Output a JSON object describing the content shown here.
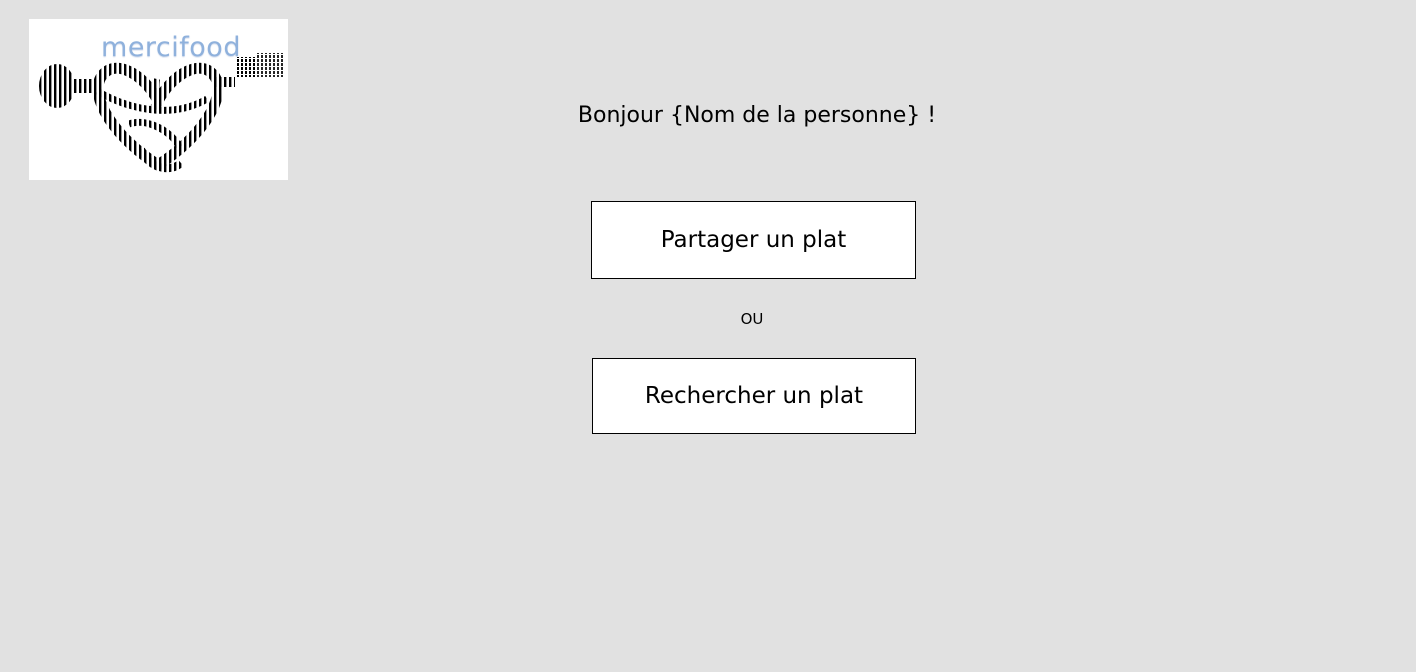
{
  "logo": {
    "text": "mercifood",
    "text_color": "#8fb1dc"
  },
  "greeting": {
    "text": "Bonjour {Nom de la personne} !"
  },
  "actions": {
    "share_label": "Partager un plat",
    "separator": "OU",
    "search_label": "Rechercher un plat"
  },
  "colors": {
    "background": "#e1e1e1",
    "button_background": "#ffffff",
    "button_border": "#000000",
    "text": "#000000"
  }
}
